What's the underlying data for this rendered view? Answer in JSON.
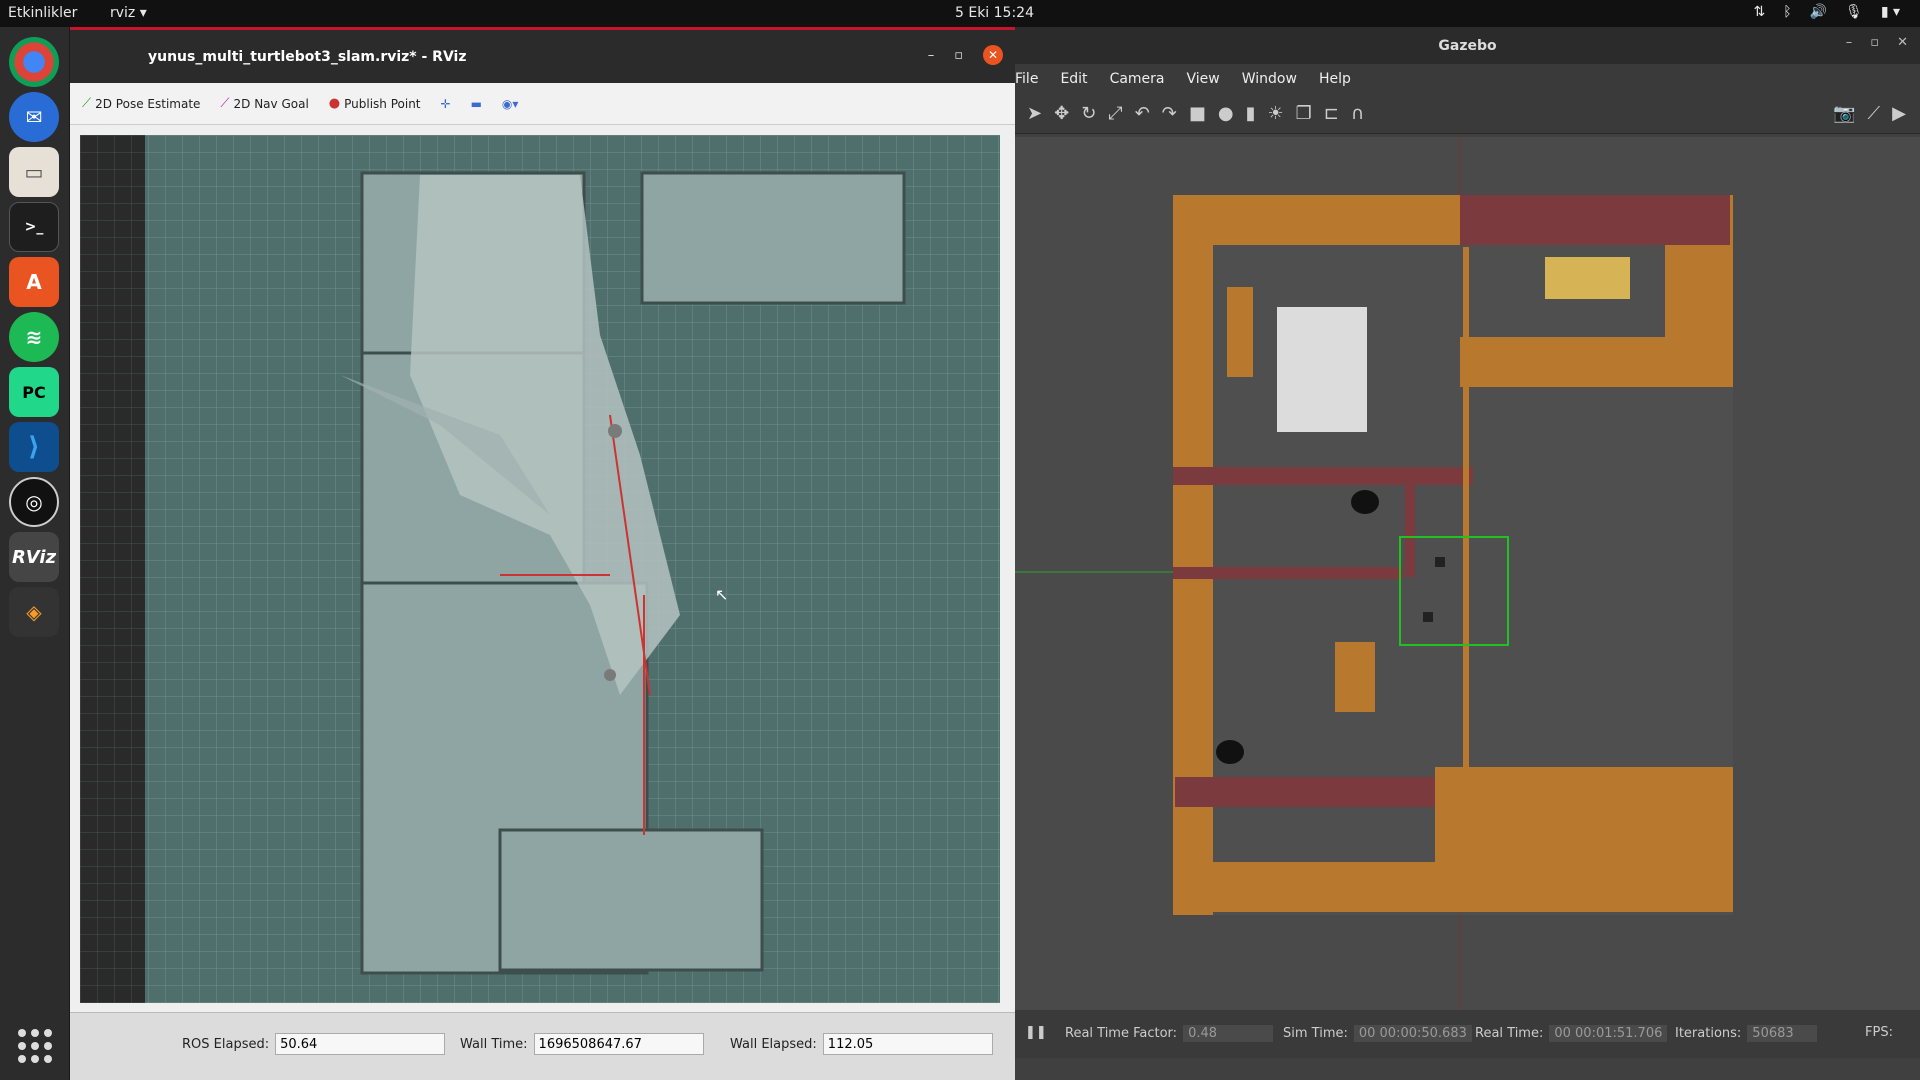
{
  "topbar": {
    "activities": "Etkinlikler",
    "app_name": "rviz",
    "clock": "5 Eki  15:24"
  },
  "dock": {
    "items": [
      "chrome-icon",
      "thunderbird-icon",
      "files-icon",
      "terminal-icon",
      "software-icon",
      "spotify-icon",
      "pycharm-icon",
      "vscode-icon",
      "obs-icon",
      "rviz-icon",
      "sublime-icon",
      "apps-grid-icon"
    ],
    "rviz_label": "RViz"
  },
  "rviz": {
    "title": "yunus_multi_turtlebot3_slam.rviz* - RViz",
    "toolbar": {
      "pose": "2D Pose Estimate",
      "nav": "2D Nav Goal",
      "publish": "Publish Point"
    },
    "status": {
      "ros_elapsed_label": "ROS Elapsed:",
      "ros_elapsed_value": "50.64",
      "wall_time_label": "Wall Time:",
      "wall_time_value": "1696508647.67",
      "wall_elapsed_label": "Wall Elapsed:",
      "wall_elapsed_value": "112.05"
    }
  },
  "gazebo": {
    "title": "Gazebo",
    "menu": [
      "File",
      "Edit",
      "Camera",
      "View",
      "Window",
      "Help"
    ],
    "status": {
      "rtf_label": "Real Time Factor:",
      "rtf_value": "0.48",
      "sim_label": "Sim Time:",
      "sim_value": "00 00:00:50.683",
      "real_label": "Real Time:",
      "real_value": "00 00:01:51.706",
      "iter_label": "Iterations:",
      "iter_value": "50683",
      "fps_label": "FPS:"
    }
  },
  "colors": {
    "map_free": "#8fa5a3",
    "map_bg": "#4f6f6d",
    "wall_wood": "#b8782e",
    "wall_brick": "#7a3a3e",
    "selection": "#22c022"
  }
}
